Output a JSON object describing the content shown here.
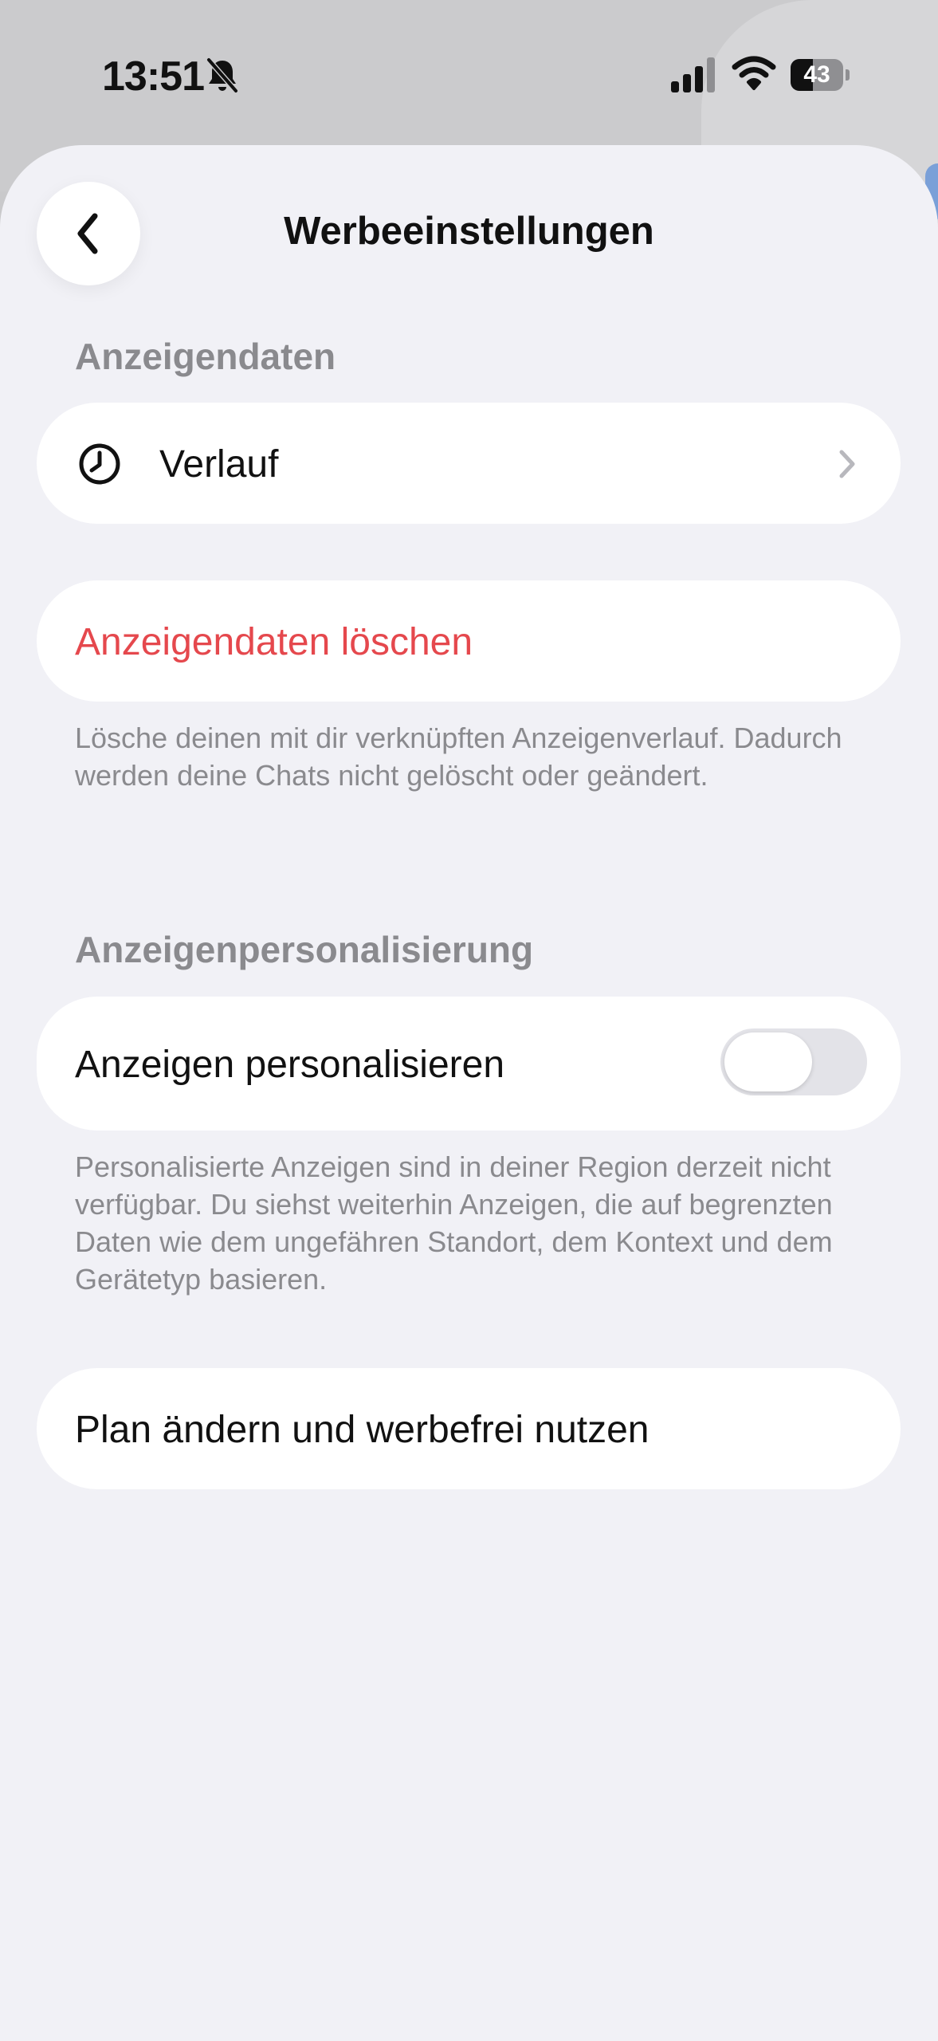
{
  "status_bar": {
    "time": "13:51",
    "battery_level": "43",
    "battery_fraction": 0.43
  },
  "header": {
    "title": "Werbeeinstellungen"
  },
  "sections": {
    "ad_data": {
      "header": "Anzeigendaten",
      "history_label": "Verlauf",
      "delete_label": "Anzeigendaten löschen",
      "delete_footnote": "Lösche deinen mit dir verknüpften Anzeigenverlauf. Dadurch werden deine Chats nicht gelöscht oder geändert."
    },
    "personalization": {
      "header": "Anzeigenpersonalisierung",
      "toggle_label": "Anzeigen personalisieren",
      "toggle_on": false,
      "footnote": "Personalisierte Anzeigen sind in deiner Region derzeit nicht verfügbar. Du siehst weiterhin Anzeigen, die auf begrenzten Daten wie dem ungefähren Standort, dem Kontext und dem Gerätetyp basieren."
    },
    "plan": {
      "label": "Plan ändern und werbefrei nutzen"
    }
  },
  "colors": {
    "destructive": "#e5484d",
    "background": "#f1f1f6",
    "card": "#ffffff",
    "secondary_text": "#8a8a8e",
    "toggle_off": "#e3e3e8"
  },
  "icons": {
    "back": "chevron-left-icon",
    "history": "clock-icon",
    "disclosure": "chevron-right-icon",
    "silent": "bell-slash-icon",
    "signal": "cellular-signal-icon",
    "wifi": "wifi-icon",
    "battery": "battery-icon"
  }
}
